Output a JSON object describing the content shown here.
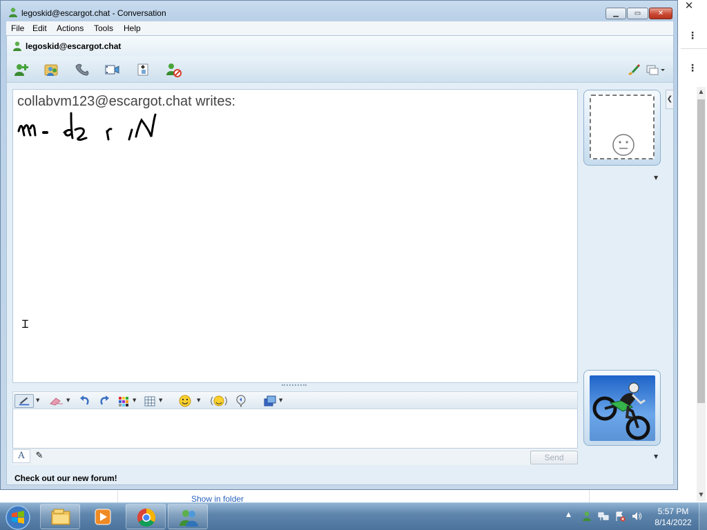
{
  "window": {
    "title": "legoskid@escargot.chat - Conversation",
    "minimize_glyph": "▁",
    "maximize_glyph": "▭",
    "close_glyph": "✕"
  },
  "menu": [
    "File",
    "Edit",
    "Actions",
    "Tools",
    "Help"
  ],
  "contact": {
    "name": "legoskid@escargot.chat"
  },
  "toolbar": {
    "icons": [
      "invite-contact-icon",
      "share-files-icon",
      "call-icon",
      "video-icon",
      "games-icon",
      "block-icon",
      "paintbrush-icon",
      "display-options-icon"
    ]
  },
  "history": {
    "line": "collabvm123@escargot.chat writes:",
    "ink_text": "modern"
  },
  "format_bar": {
    "icons": [
      "handwriting-pen-icon",
      "eraser-icon",
      "undo-icon",
      "redo-icon",
      "color-grid-icon",
      "canvas-grid-icon",
      "emoticon-icon",
      "wink-icon",
      "nudge-icon",
      "activities-icon"
    ]
  },
  "input": {
    "text_tab_glyph": "A",
    "handwriting_tab_glyph": "✎",
    "send_label": "Send"
  },
  "status": {
    "text": "Check out our new forum!"
  },
  "background": {
    "close_glyph": "✕",
    "kebab_glyph": "⋮",
    "show_in_folder": "Show in folder"
  },
  "taskbar": {
    "apps": [
      "file-explorer-icon",
      "media-player-icon",
      "chrome-icon",
      "messenger-icon"
    ],
    "tray_up_glyph": "▲",
    "time": "5:57 PM",
    "date": "8/14/2022"
  },
  "colors": {
    "window_frame": "#b8cfe7",
    "close_button": "#c9452f",
    "link": "#2a62bd",
    "taskbar": "#5f86ad"
  }
}
